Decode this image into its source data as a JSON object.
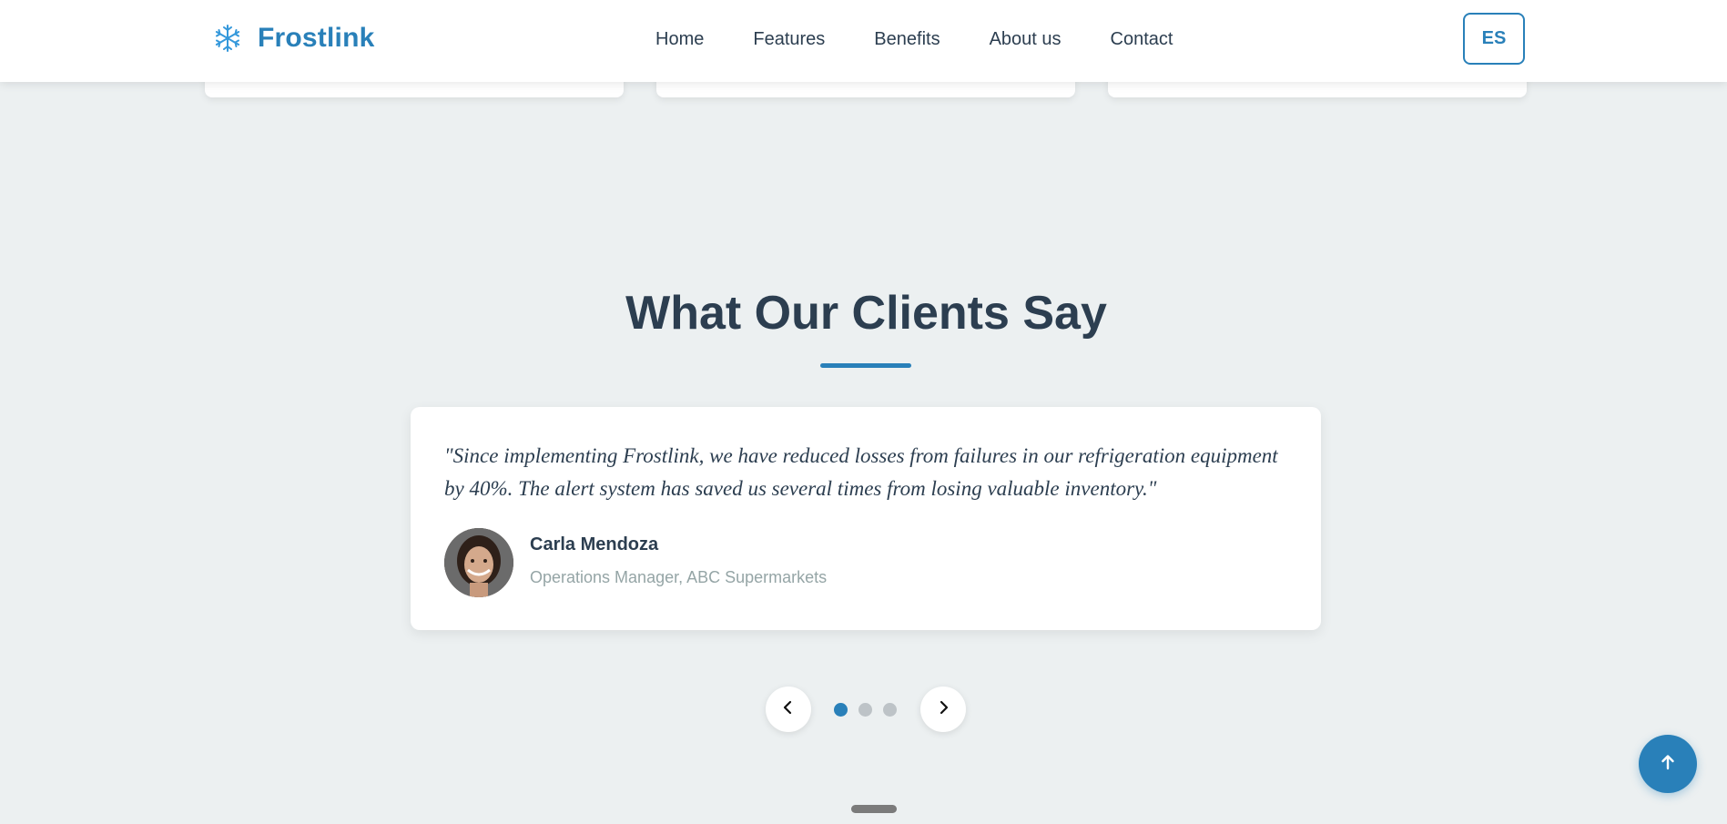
{
  "header": {
    "brand_name": "Frostlink",
    "brand_icon": "snowflake-icon",
    "nav": [
      {
        "label": "Home"
      },
      {
        "label": "Features"
      },
      {
        "label": "Benefits"
      },
      {
        "label": "About us"
      },
      {
        "label": "Contact"
      }
    ],
    "language_button": "ES"
  },
  "testimonials": {
    "title": "What Our Clients Say",
    "active": {
      "quote": "\"Since implementing Frostlink, we have reduced losses from failures in our refrigeration equipment by 40%. The alert system has saved us several times from losing valuable inventory.\"",
      "author_name": "Carla Mendoza",
      "author_role": "Operations Manager, ABC Supermarkets"
    },
    "dots_count": 3,
    "active_index": 0,
    "prev_icon": "chevron-left-icon",
    "next_icon": "chevron-right-icon"
  },
  "scroll_top_icon": "arrow-up-icon",
  "colors": {
    "accent": "#2980b9",
    "text": "#2c3e50",
    "muted": "#95a5a6",
    "background": "#ecf0f1"
  }
}
